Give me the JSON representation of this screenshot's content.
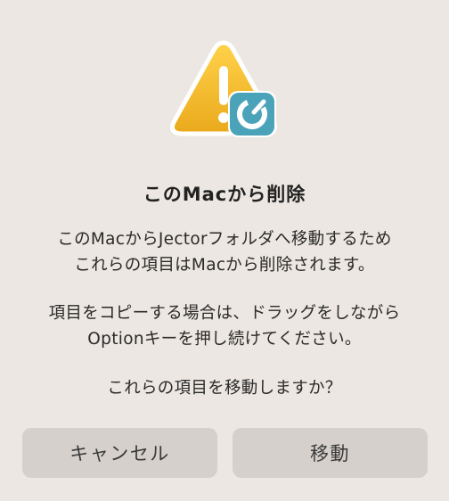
{
  "dialog": {
    "icon": "warning-triangle-with-app-badge",
    "title": "このMacから削除",
    "message_line1": "このMacからJectorフォルダへ移動するため",
    "message_line2": "これらの項目はMacから削除されます。",
    "message_line3": "項目をコピーする場合は、ドラッグをしながら",
    "message_line4": "Optionキーを押し続けてください。",
    "message_line5": "これらの項目を移動しますか？",
    "cancel_label": "キャンセル",
    "move_label": "移動"
  },
  "colors": {
    "background": "#ece7e2",
    "button": "#d5d0cb",
    "warning": "#f2b62a",
    "badge": "#4aa3b8"
  }
}
